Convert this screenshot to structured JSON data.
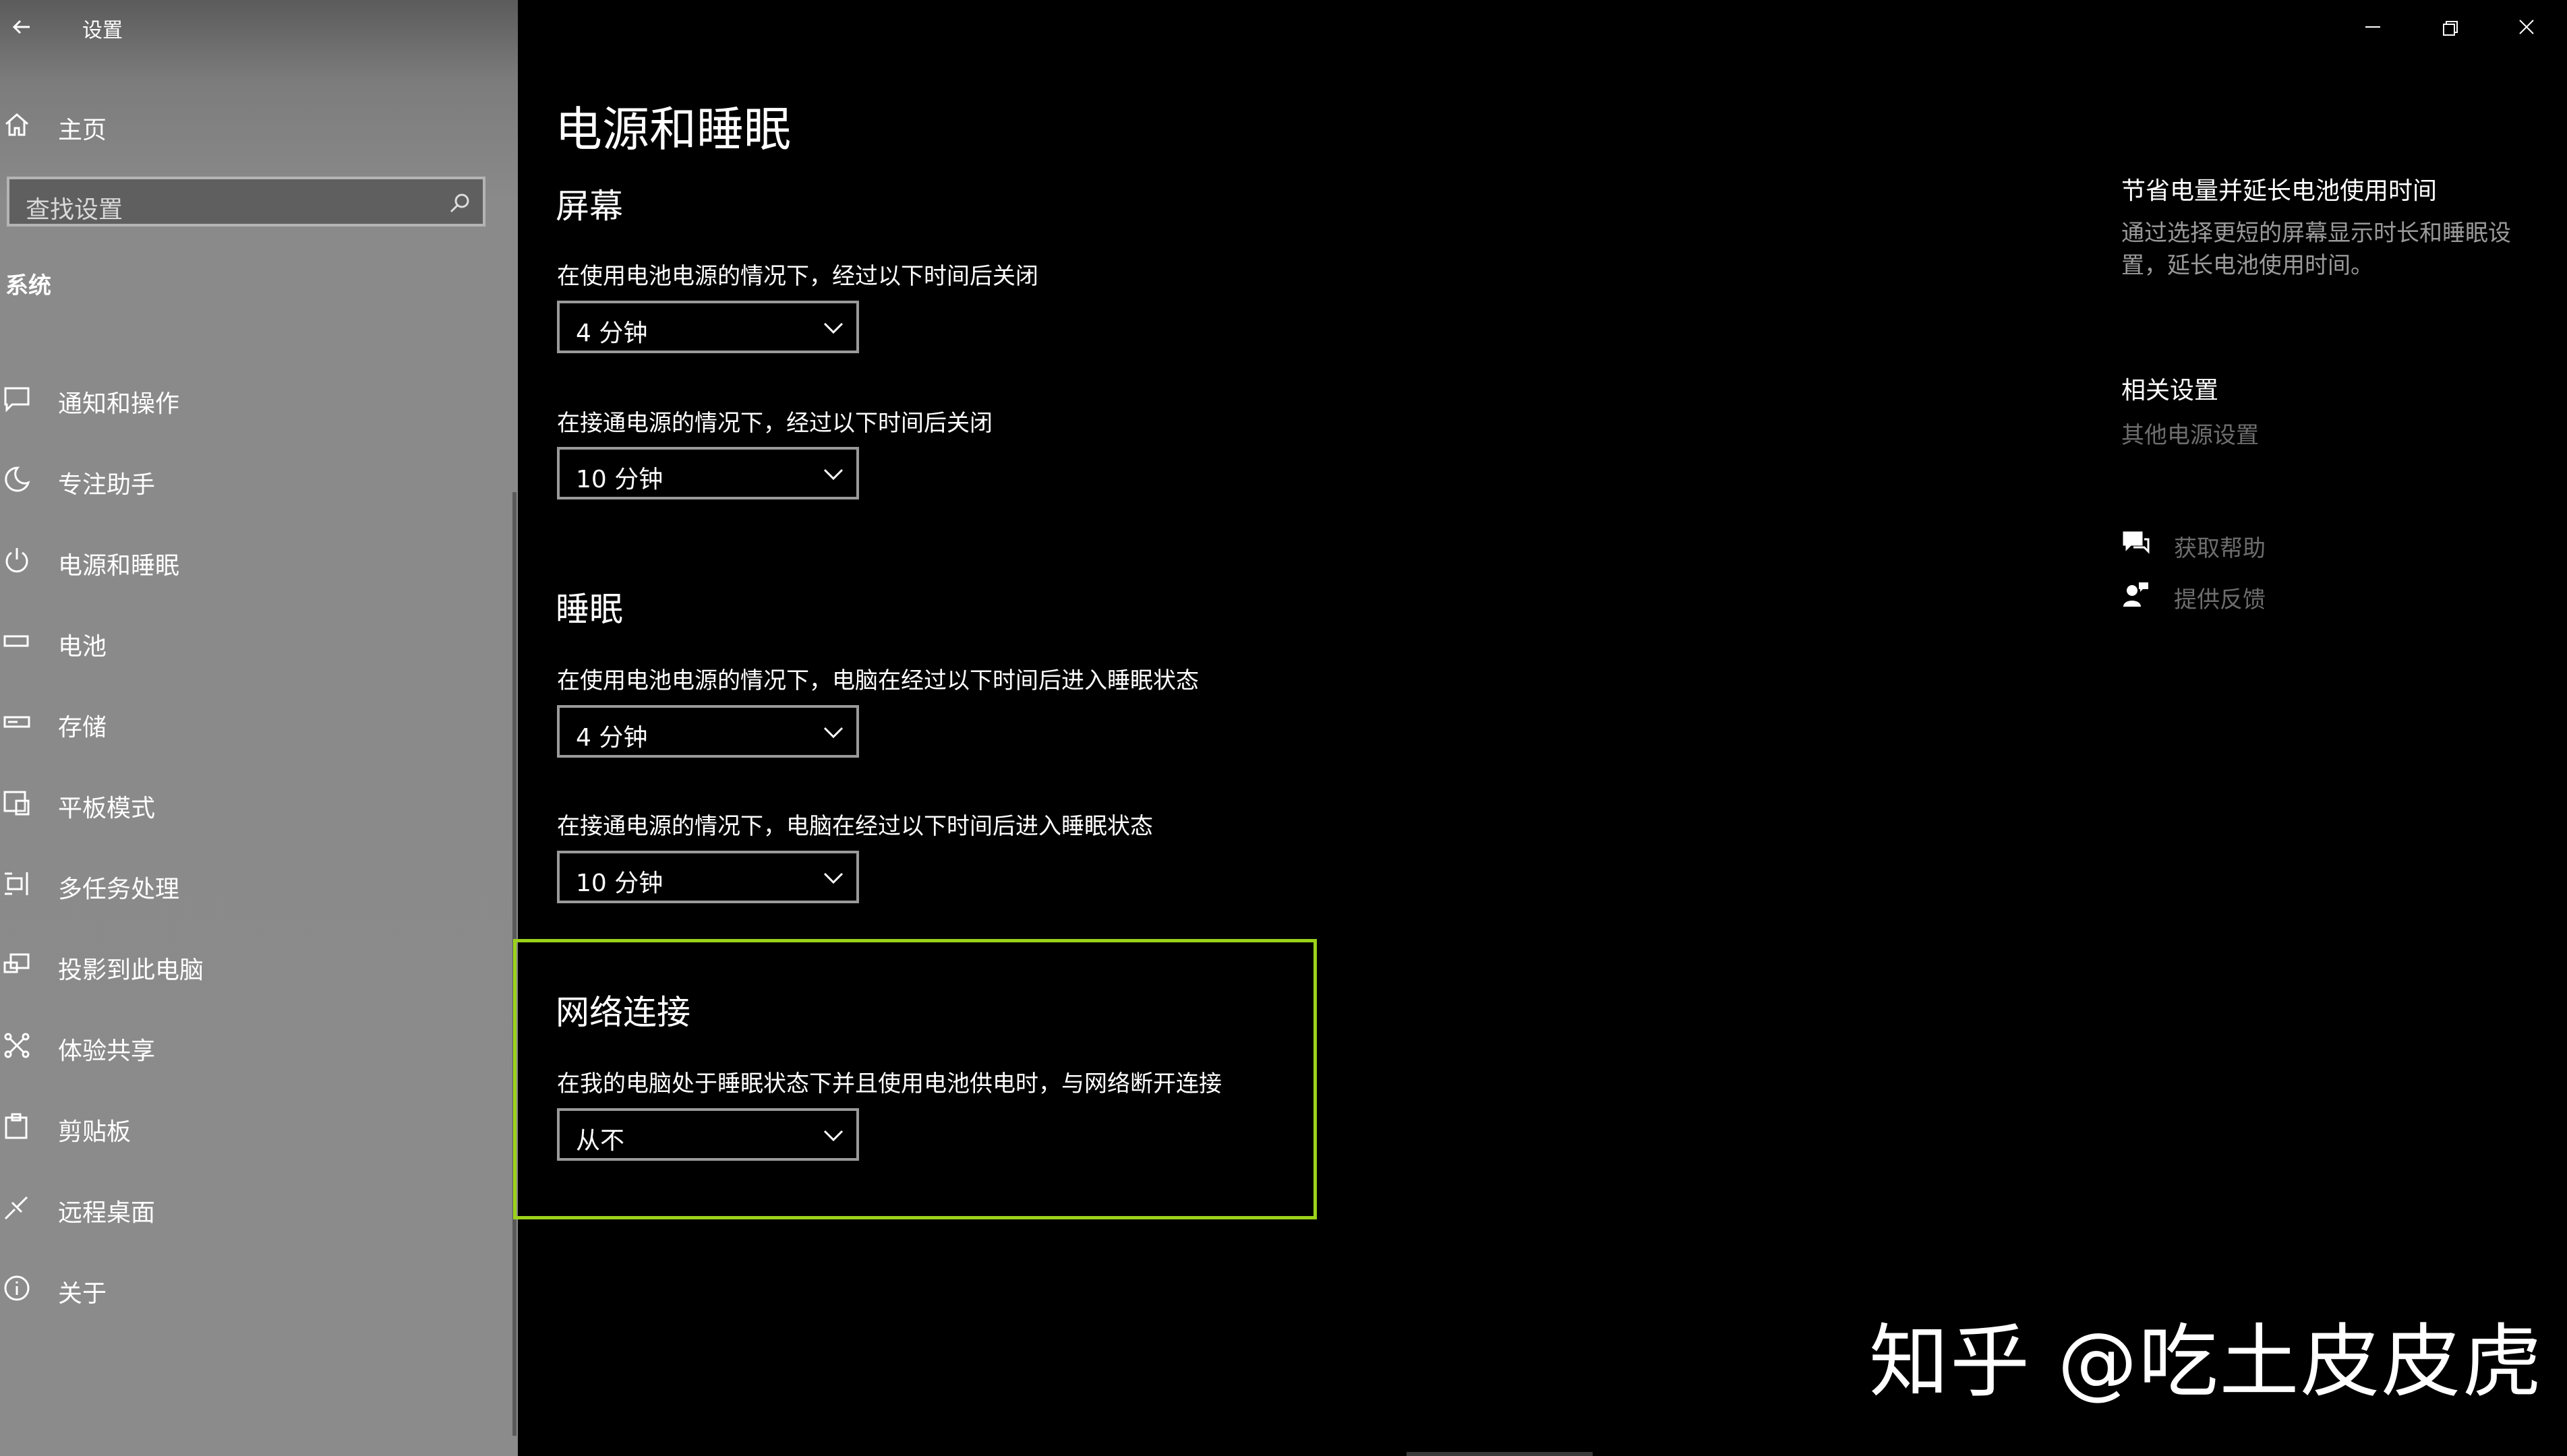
{
  "app": {
    "title": "设置"
  },
  "sidebar": {
    "home_label": "主页",
    "search": {
      "placeholder": "查找设置"
    },
    "section": "系统",
    "items": [
      {
        "label": "通知和操作",
        "icon": "message-icon"
      },
      {
        "label": "专注助手",
        "icon": "moon-icon"
      },
      {
        "label": "电源和睡眠",
        "icon": "power-icon"
      },
      {
        "label": "电池",
        "icon": "battery-icon"
      },
      {
        "label": "存储",
        "icon": "storage-icon"
      },
      {
        "label": "平板模式",
        "icon": "tablet-icon"
      },
      {
        "label": "多任务处理",
        "icon": "multitask-icon"
      },
      {
        "label": "投影到此电脑",
        "icon": "project-icon"
      },
      {
        "label": "体验共享",
        "icon": "share-icon"
      },
      {
        "label": "剪贴板",
        "icon": "clipboard-icon"
      },
      {
        "label": "远程桌面",
        "icon": "remote-desktop-icon"
      },
      {
        "label": "关于",
        "icon": "info-icon"
      }
    ]
  },
  "main": {
    "page_title": "电源和睡眠",
    "screen": {
      "heading": "屏幕",
      "battery_label": "在使用电池电源的情况下，经过以下时间后关闭",
      "battery_value": "4 分钟",
      "plugged_label": "在接通电源的情况下，经过以下时间后关闭",
      "plugged_value": "10 分钟"
    },
    "sleep": {
      "heading": "睡眠",
      "battery_label": "在使用电池电源的情况下，电脑在经过以下时间后进入睡眠状态",
      "battery_value": "4 分钟",
      "plugged_label": "在接通电源的情况下，电脑在经过以下时间后进入睡眠状态",
      "plugged_value": "10 分钟"
    },
    "network": {
      "heading": "网络连接",
      "label": "在我的电脑处于睡眠状态下并且使用电池供电时，与网络断开连接",
      "value": "从不"
    }
  },
  "right_panel": {
    "tip_heading": "节省电量并延长电池使用时间",
    "tip_text": "通过选择更短的屏幕显示时长和睡眠设置，延长电池使用时间。",
    "related_heading": "相关设置",
    "related_link": "其他电源设置",
    "help_label": "获取帮助",
    "feedback_label": "提供反馈"
  },
  "watermark": "知乎 @吃土皮皮虎",
  "colors": {
    "highlight": "#9bd21a",
    "background": "#000000",
    "sidebar": "#8a8a8a"
  }
}
